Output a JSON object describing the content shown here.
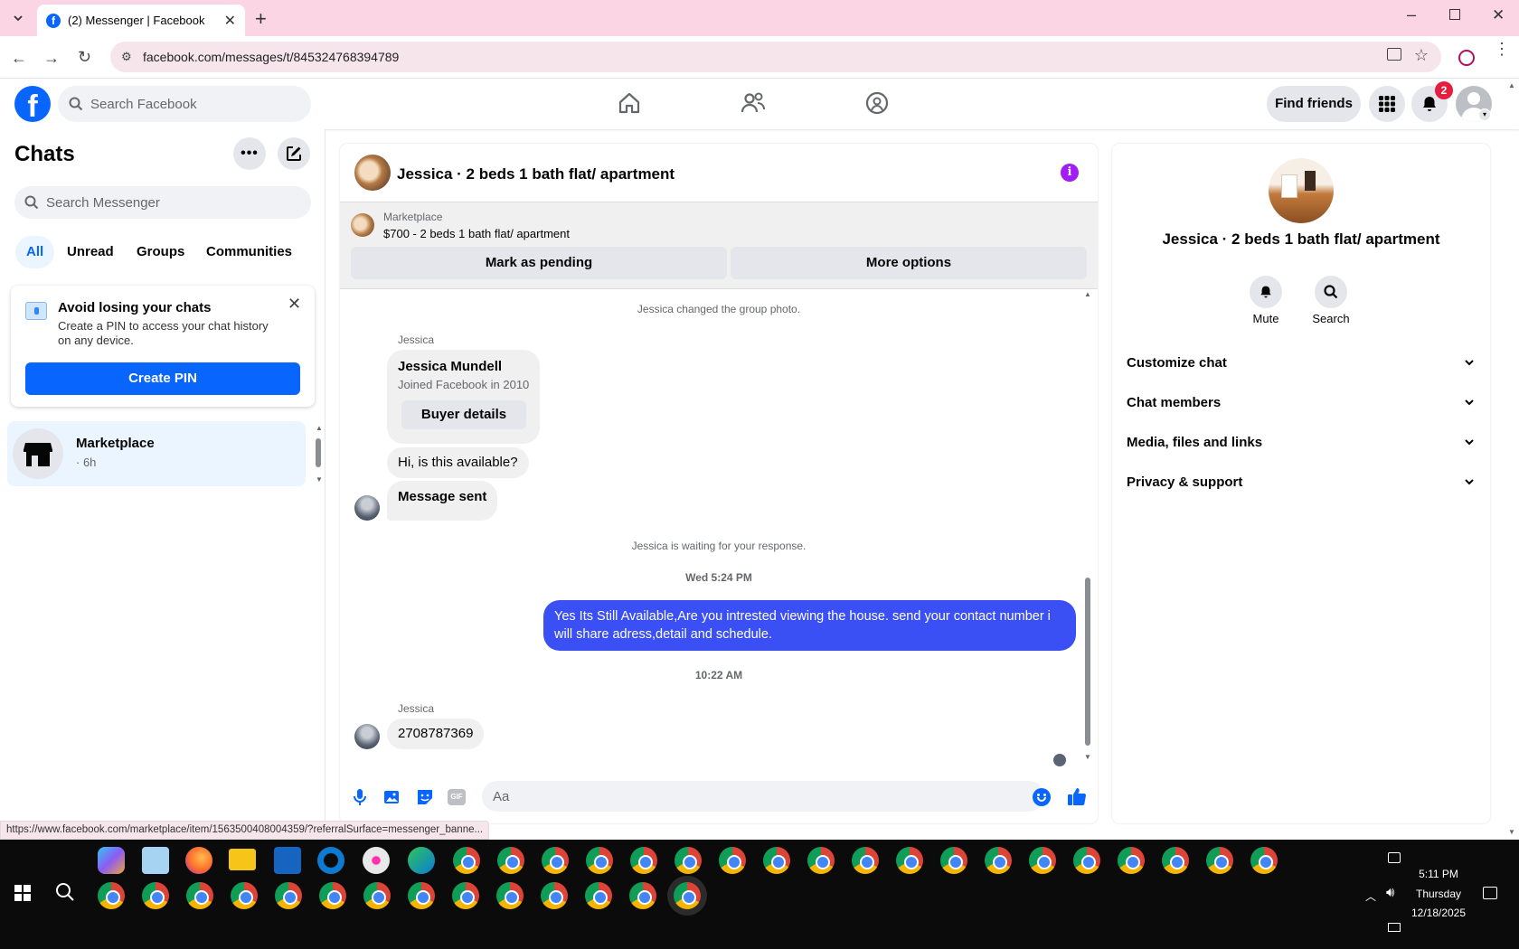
{
  "browser": {
    "tab_title": "(2) Messenger | Facebook",
    "url": "facebook.com/messages/t/845324768394789",
    "status_url": "https://www.facebook.com/marketplace/item/1563500408004359/?referralSurface=messenger_banne..."
  },
  "header": {
    "search_placeholder": "Search Facebook",
    "find_friends": "Find friends",
    "notif_count": "2"
  },
  "sidebar": {
    "title": "Chats",
    "search_placeholder": "Search Messenger",
    "filters": [
      "All",
      "Unread",
      "Groups",
      "Communities"
    ],
    "pin_card": {
      "title": "Avoid losing your chats",
      "body": "Create a PIN to access your chat history on any device.",
      "button": "Create PIN"
    },
    "chats": [
      {
        "name": "Marketplace",
        "meta": "· 6h"
      }
    ]
  },
  "conversation": {
    "title": "Jessica · 2 beds 1 bath flat/ apartment",
    "listing_source": "Marketplace",
    "listing_title": "$700 - 2 beds 1 bath flat/ apartment",
    "mark_pending": "Mark as pending",
    "more_options": "More options",
    "messages": {
      "sys_photo": "Jessica changed the group photo.",
      "sender1": "Jessica",
      "card_name": "Jessica Mundell",
      "card_joined": "Joined Facebook in 2010",
      "card_button": "Buyer details",
      "msg1": "Hi, is this available?",
      "msg2": "Message sent",
      "sys_waiting": "Jessica is waiting for your response.",
      "time1": "Wed 5:24 PM",
      "outgoing": "Yes Its Still Available,Are you intrested viewing the house. send your contact number i will share adress,detail and schedule.",
      "time2": "10:22 AM",
      "sender2": "Jessica",
      "msg3": "2708787369"
    },
    "composer_placeholder": "Aa"
  },
  "info_panel": {
    "title": "Jessica · 2 beds 1 bath flat/ apartment",
    "mute": "Mute",
    "search": "Search",
    "sections": [
      "Customize chat",
      "Chat members",
      "Media, files and links",
      "Privacy & support"
    ]
  },
  "taskbar": {
    "time": "5:11 PM",
    "day": "Thursday",
    "date": "12/18/2025"
  },
  "colors": {
    "fb_blue": "#0866ff",
    "messenger_blue": "#3a50f4",
    "tab_bar": "#fbd5e3",
    "info_purple": "#a21cf3"
  }
}
